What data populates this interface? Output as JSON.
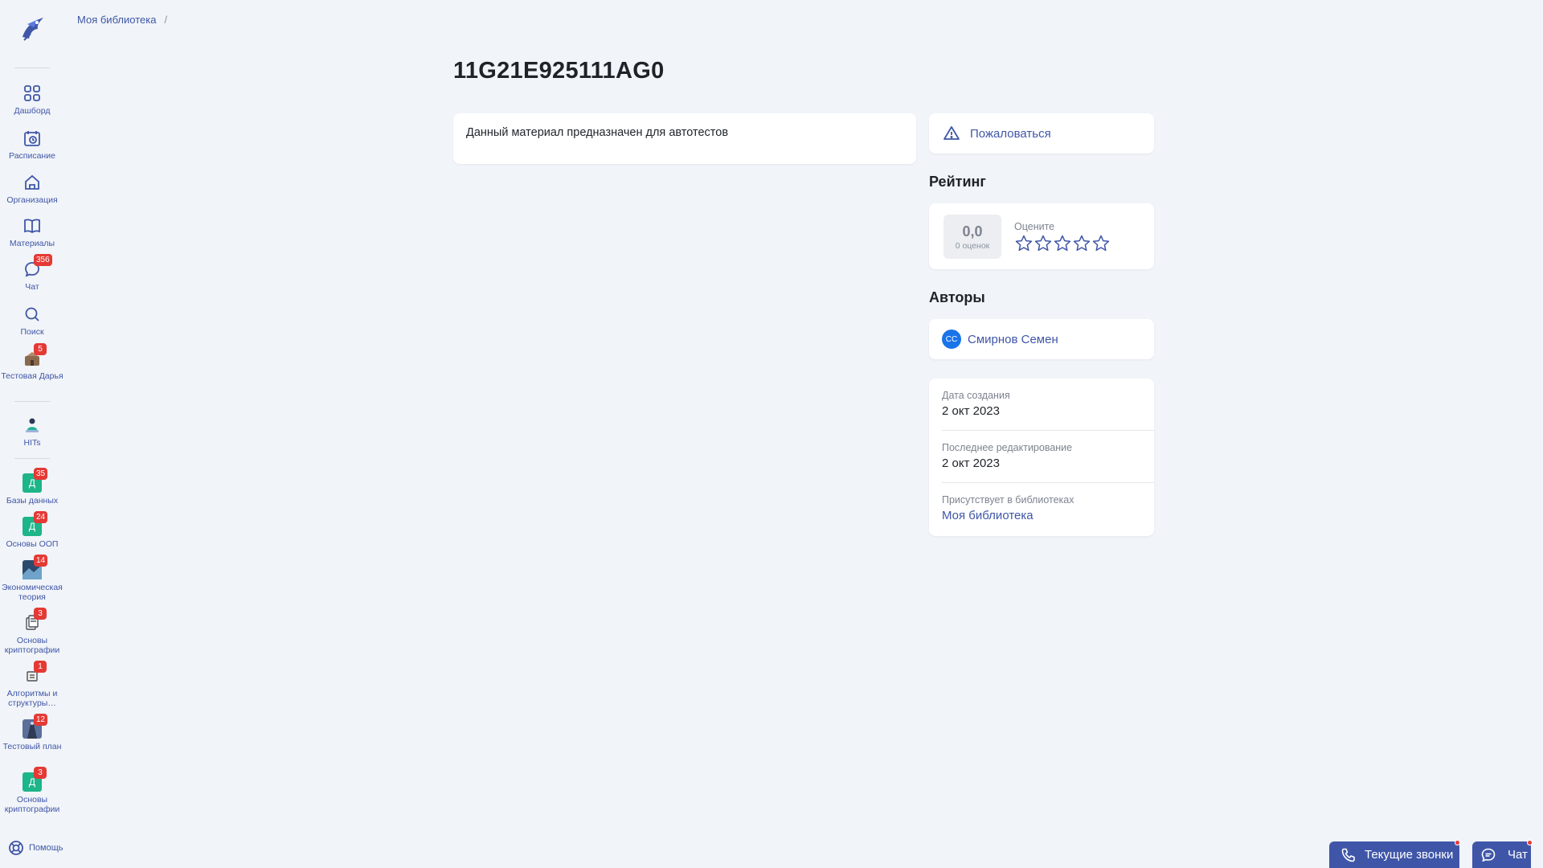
{
  "breadcrumb": {
    "root_label": "Моя библиотека",
    "separator": "/"
  },
  "page": {
    "title": "11G21E925111AG0",
    "description": "Данный материал предназначен для автотестов"
  },
  "report": {
    "label": "Пожаловаться",
    "icon": "warning-triangle-icon"
  },
  "rating": {
    "section_title": "Рейтинг",
    "value": "0,0",
    "count_label": "0 оценок",
    "rate_label": "Оцените",
    "stars_total": 5,
    "stars_filled": 0
  },
  "authors": {
    "section_title": "Авторы",
    "items": [
      {
        "initials": "СС",
        "name": "Смирнов Семен"
      }
    ]
  },
  "meta": {
    "created_label": "Дата создания",
    "created_value": "2 окт 2023",
    "edited_label": "Последнее редактирование",
    "edited_value": "2 окт 2023",
    "libraries_label": "Присутствует в библиотеках",
    "libraries_value": "Моя библиотека"
  },
  "sidebar": {
    "items": [
      {
        "label": "Дашборд",
        "icon": "dashboard-grid-icon"
      },
      {
        "label": "Расписание",
        "icon": "calendar-clock-icon"
      },
      {
        "label": "Организация",
        "icon": "home-icon"
      },
      {
        "label": "Материалы",
        "icon": "book-icon"
      },
      {
        "label": "Чат",
        "icon": "chat-bubble-icon",
        "badge": "356"
      },
      {
        "label": "Поиск",
        "icon": "search-icon"
      },
      {
        "label": "Тестовая Дарья",
        "icon": "org-image-icon",
        "badge": "5"
      },
      {
        "label": "HITs",
        "icon": "hits-person-icon"
      }
    ],
    "courses": [
      {
        "label": "Базы данных",
        "tile": "Д",
        "badge": "35",
        "color": "#1db58a"
      },
      {
        "label": "Основы ООП",
        "tile": "Д",
        "badge": "24",
        "color": "#1db58a"
      },
      {
        "label": "Экономическая теория",
        "tile": "",
        "badge": "14",
        "color": "#2c4a6e"
      },
      {
        "label": "Основы криптографии",
        "tile": "",
        "badge": "3",
        "color": "#ffffff"
      },
      {
        "label": "Алгоритмы и структуры…",
        "tile": "",
        "badge": "1",
        "color": "#ffffff"
      },
      {
        "label": "Тестовый план",
        "tile": "",
        "badge": "12",
        "color": "#5a6f9a"
      },
      {
        "label": "Основы криптографии",
        "tile": "Д",
        "badge": "3",
        "color": "#1db58a"
      }
    ],
    "help_label": "Помощь"
  },
  "footer": {
    "calls_label": "Текущие звонки",
    "chat_label": "Чат"
  },
  "colors": {
    "accent": "#3f56a8",
    "badge": "#e53935",
    "background": "#f1f4f8",
    "avatar": "#1a73e8"
  }
}
